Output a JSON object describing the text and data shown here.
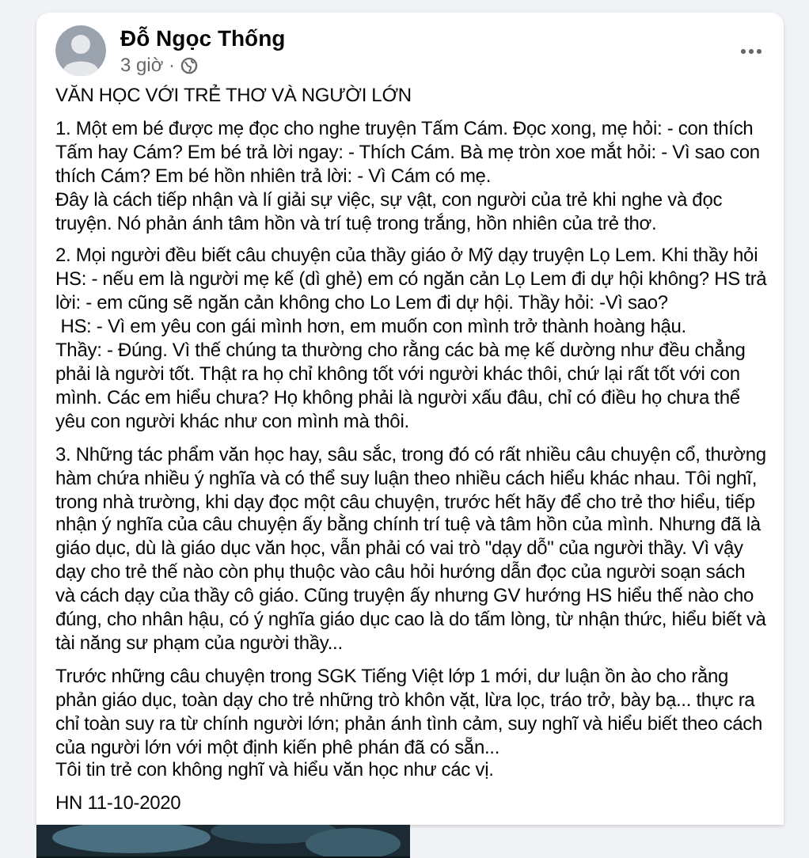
{
  "post": {
    "author": "Đỗ Ngọc Thống",
    "time": "3 giờ ·",
    "title": "VĂN HỌC VỚI TRẺ THƠ VÀ NGƯỜI LỚN",
    "paragraphs": [
      "1. Một em bé được mẹ đọc cho nghe truyện Tấm Cám. Đọc xong, mẹ hỏi: - con thích Tấm hay Cám? Em bé trả lời ngay: - Thích Cám. Bà mẹ tròn xoe mắt hỏi: - Vì sao con thích Cám? Em bé hồn nhiên trả lời: - Vì Cám có mẹ.\nĐây là cách tiếp nhận và lí giải sự việc, sự vật, con người của trẻ khi nghe và đọc truyện. Nó phản ánh tâm hồn và trí tuệ trong trắng, hồn nhiên của trẻ thơ.",
      "2. Mọi người đều biết câu chuyện của thầy giáo ở Mỹ dạy truyện Lọ Lem. Khi thầy hỏi HS: - nếu em là người mẹ kế (dì ghẻ) em có ngăn cản Lọ Lem đi dự hội không? HS trả lời: - em cũng sẽ ngăn cản không cho Lo Lem đi dự hội. Thầy hỏi: -Vì sao?\n HS: - Vì em yêu con gái mình hơn, em muốn con mình trở thành hoàng hậu.\nThầy: - Đúng. Vì thế chúng ta thường cho rằng các bà mẹ kế dường như đều chẳng phải là người tốt. Thật ra họ chỉ không tốt với người khác thôi, chứ lại rất tốt với con mình. Các em hiểu chưa? Họ không phải là người xấu đâu, chỉ có điều họ chưa thể yêu con người khác như con mình mà thôi.",
      "3. Những tác phẩm văn học hay, sâu sắc, trong đó có rất nhiều câu chuyện cổ, thường hàm chứa nhiều ý nghĩa và có thể suy luận theo nhiều cách hiểu khác nhau. Tôi nghĩ, trong nhà trường, khi dạy đọc một câu chuyện, trước hết hãy để cho trẻ thơ hiểu, tiếp nhận ý nghĩa của câu chuyện ấy bằng chính trí tuệ và tâm hồn của mình. Nhưng đã là giáo dục, dù là giáo dục văn học, vẫn phải có vai trò \"dạy dỗ\" của người thầy. Vì vậy dạy cho trẻ thế nào còn phụ thuộc vào câu hỏi hướng dẫn đọc của người soạn sách và cách dạy của thầy cô giáo. Cũng truyện ấy nhưng GV hướng HS hiểu thế nào cho đúng, cho nhân hậu, có ý nghĩa giáo dục cao là do tấm lòng, từ nhận thức, hiểu biết và tài năng sư phạm của người thầy...",
      "Trước những câu chuyện trong SGK Tiếng Việt lớp 1 mới, dư luận ồn ào cho rằng phản giáo dục, toàn dạy cho trẻ những trò khôn vặt, lừa lọc, tráo trở, bày bạ... thực ra chỉ toàn suy ra từ chính người lớn; phản ánh tình cảm, suy nghĩ và hiểu biết theo cách của người lớn với một định kiến phê phán đã có sẵn...\nTôi tin trẻ con không nghĩ và hiểu văn học như các vị.",
      "HN 11-10-2020"
    ]
  }
}
